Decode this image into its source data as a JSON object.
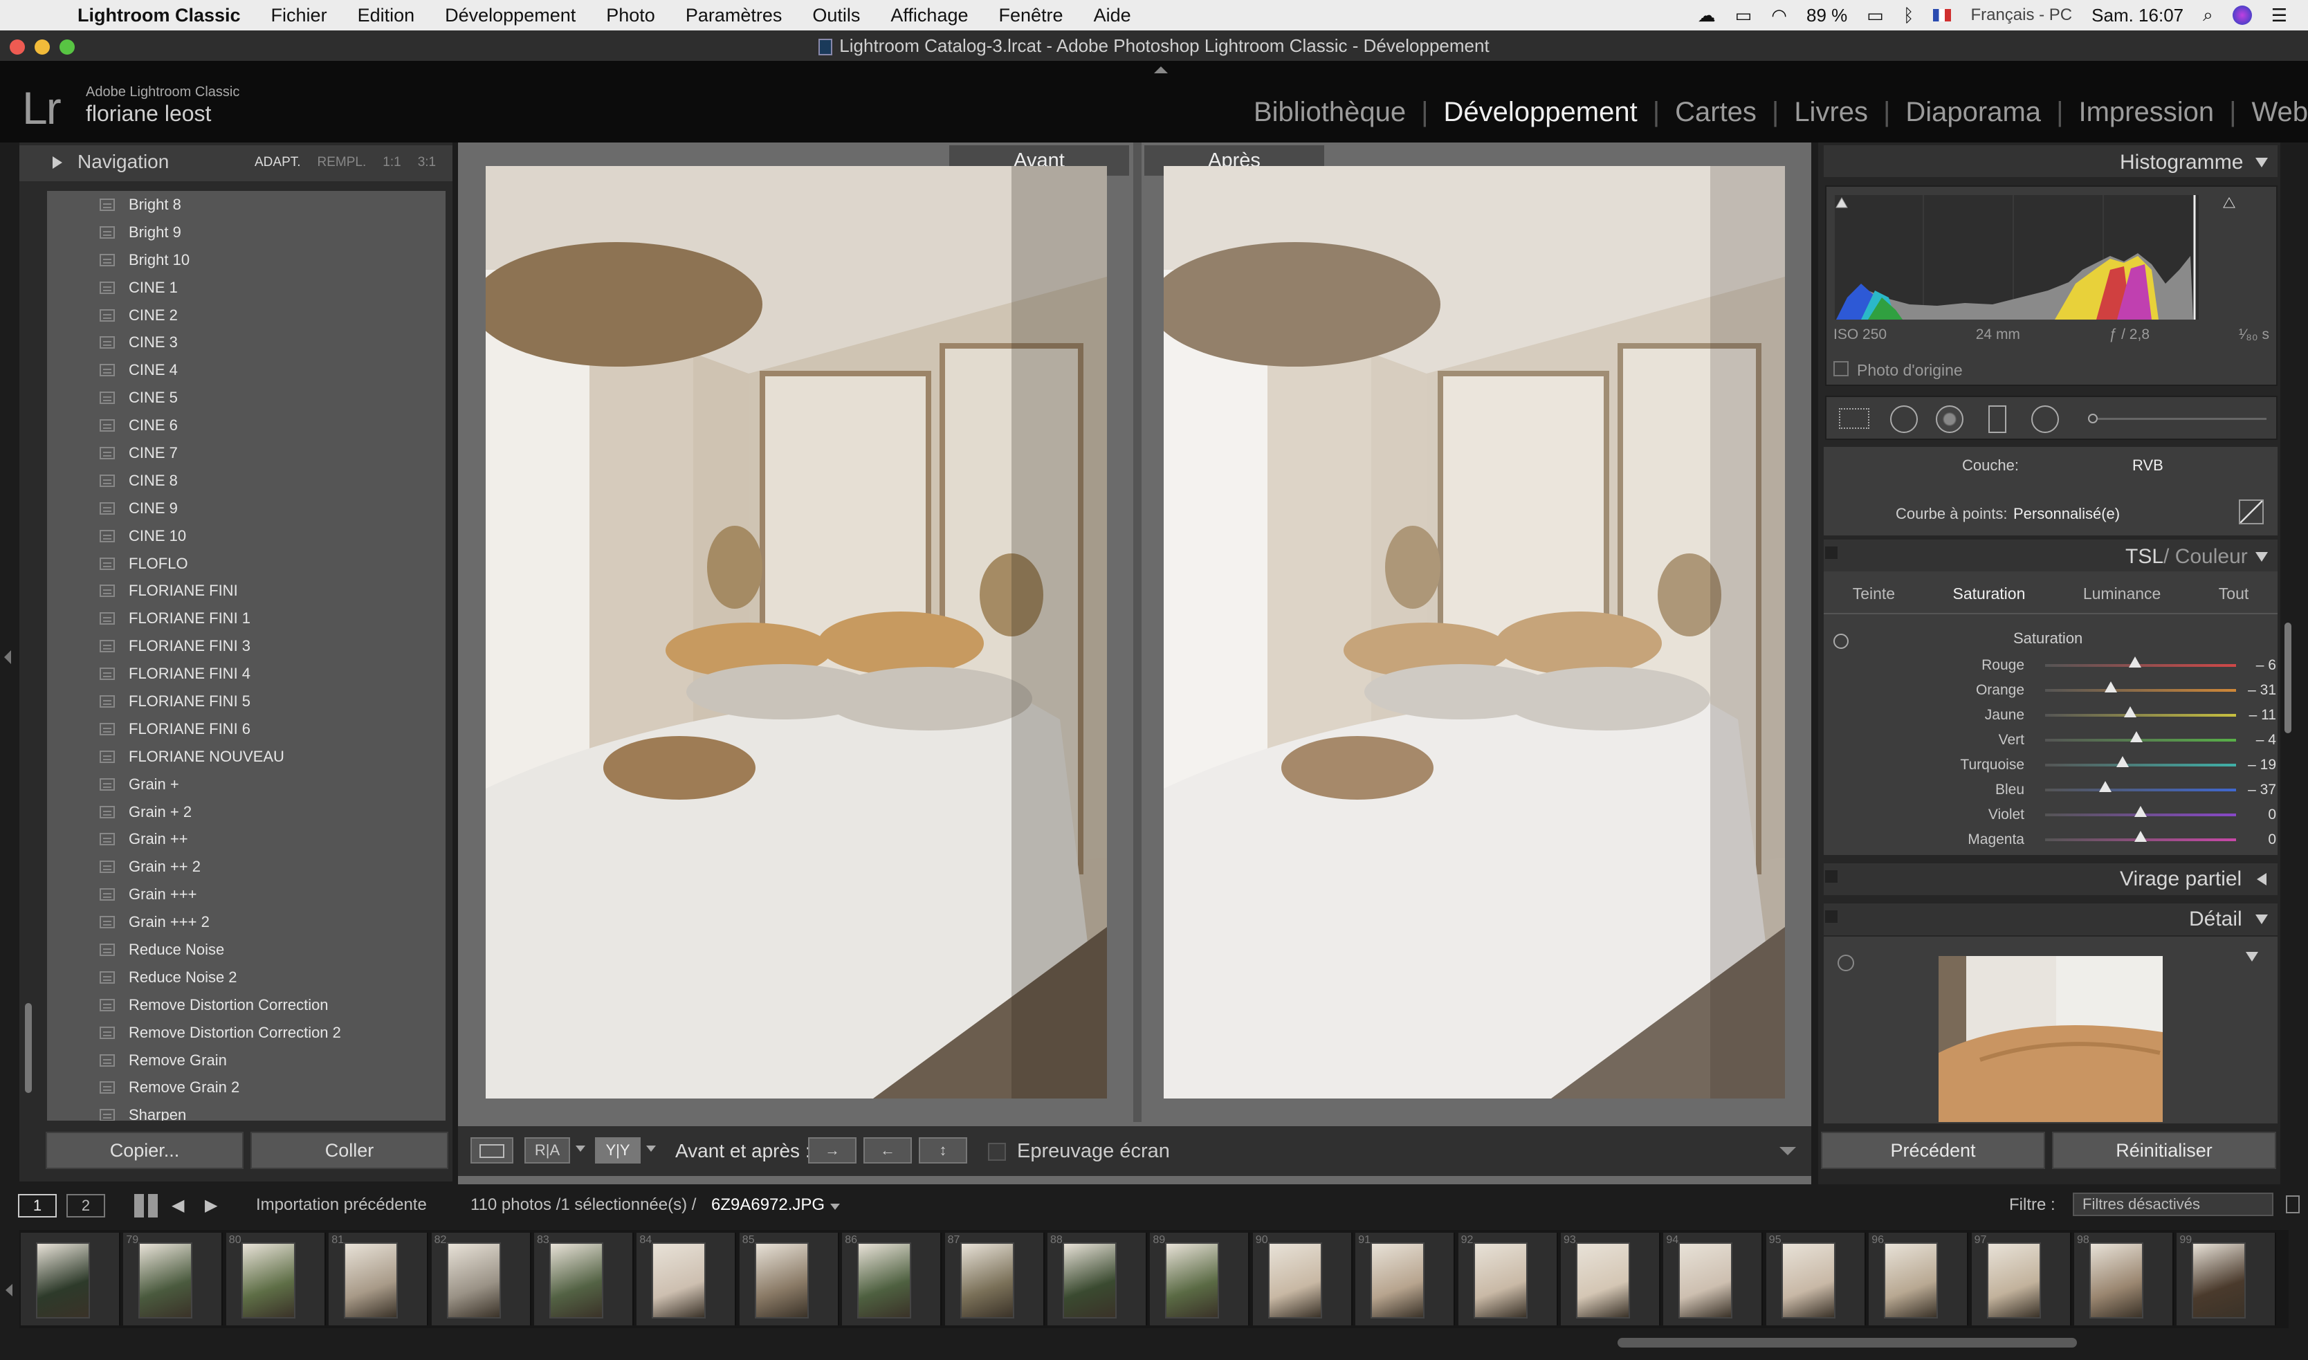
{
  "menubar": {
    "app": "Lightroom Classic",
    "items": [
      "Fichier",
      "Edition",
      "Développement",
      "Photo",
      "Paramètres",
      "Outils",
      "Affichage",
      "Fenêtre",
      "Aide"
    ],
    "battery": "89 %",
    "language": "Français - PC",
    "clock": "Sam. 16:07"
  },
  "window": {
    "title": "Lightroom Catalog-3.lrcat - Adobe Photoshop Lightroom Classic - Développement"
  },
  "identity": {
    "logo": "Lr",
    "product": "Adobe Lightroom Classic",
    "user": "floriane leost"
  },
  "modules": [
    "Bibliothèque",
    "Développement",
    "Cartes",
    "Livres",
    "Diaporama",
    "Impression",
    "Web"
  ],
  "left": {
    "navigator_title": "Navigation",
    "zoom_options": [
      "ADAPT.",
      "REMPL.",
      "1:1",
      "3:1"
    ],
    "presets": [
      "Bright 8",
      "Bright 9",
      "Bright 10",
      "CINE 1",
      "CINE 2",
      "CINE 3",
      "CINE 4",
      "CINE 5",
      "CINE 6",
      "CINE 7",
      "CINE 8",
      "CINE 9",
      "CINE 10",
      "FLOFLO",
      "FLORIANE FINI",
      "FLORIANE FINI 1",
      "FLORIANE FINI 3",
      "FLORIANE FINI 4",
      "FLORIANE FINI 5",
      "FLORIANE FINI 6",
      "FLORIANE NOUVEAU",
      "Grain +",
      "Grain + 2",
      "Grain ++",
      "Grain ++ 2",
      "Grain +++",
      "Grain +++ 2",
      "Reduce Noise",
      "Reduce Noise 2",
      "Remove Distortion Correction",
      "Remove Distortion Correction 2",
      "Remove Grain",
      "Remove Grain 2",
      "Sharpen"
    ],
    "copy_label": "Copier...",
    "paste_label": "Coller"
  },
  "center": {
    "before_label": "Avant",
    "after_label": "Après",
    "toolbar": {
      "view_label": "Avant et après :",
      "proof_label": "Epreuvage écran",
      "ra": "R|A",
      "yy": "Y|Y"
    }
  },
  "right": {
    "histogram_title": "Histogramme",
    "meta": {
      "iso": "ISO 250",
      "focal": "24 mm",
      "aperture": "ƒ / 2,8",
      "shutter": "¹⁄₈₀ s"
    },
    "original_label": "Photo d'origine",
    "curve": {
      "channel_label": "Couche:",
      "channel_value": "RVB",
      "points_label": "Courbe à points:",
      "points_value": "Personnalisé(e)"
    },
    "hsl": {
      "title_a": "TSL",
      "title_b": "/ Couleur",
      "tabs": [
        "Teinte",
        "Saturation",
        "Luminance",
        "Tout"
      ],
      "active_tab": "Saturation",
      "group_label": "Saturation",
      "sliders": [
        {
          "name": "Rouge",
          "value": "– 6",
          "num": -6,
          "color": "#d04848"
        },
        {
          "name": "Orange",
          "value": "– 31",
          "num": -31,
          "color": "#d08838"
        },
        {
          "name": "Jaune",
          "value": "– 11",
          "num": -11,
          "color": "#c8c040"
        },
        {
          "name": "Vert",
          "value": "– 4",
          "num": -4,
          "color": "#58b048"
        },
        {
          "name": "Turquoise",
          "value": "– 19",
          "num": -19,
          "color": "#40b0a8"
        },
        {
          "name": "Bleu",
          "value": "– 37",
          "num": -37,
          "color": "#4068d0"
        },
        {
          "name": "Violet",
          "value": "0",
          "num": 0,
          "color": "#8848c8"
        },
        {
          "name": "Magenta",
          "value": "0",
          "num": 0,
          "color": "#c848a8"
        }
      ]
    },
    "split_toning_title": "Virage partiel",
    "detail_title": "Détail",
    "prev_label": "Précédent",
    "reset_label": "Réinitialiser"
  },
  "filmstrip": {
    "page1": "1",
    "page2": "2",
    "source": "Importation précédente",
    "count": "110 photos /1 sélectionnée(s) /",
    "filename": "6Z9A6972.JPG",
    "filter_label": "Filtre :",
    "filter_value": "Filtres désactivés",
    "numbers": [
      "",
      "79",
      "80",
      "81",
      "82",
      "83",
      "84",
      "85",
      "86",
      "87",
      "88",
      "89",
      "90",
      "91",
      "92",
      "93",
      "94",
      "95",
      "96",
      "97",
      "98",
      "99"
    ]
  }
}
